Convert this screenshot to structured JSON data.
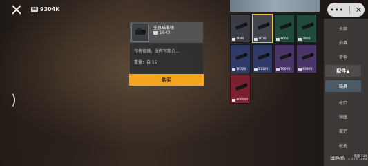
{
  "currency": {
    "amount": "9304K"
  },
  "detail": {
    "name": "全息瞄准镜",
    "price": "1640",
    "description": "作者很懒，没有写简介...",
    "weight": "重量：",
    "weight_value": "自 15",
    "buy_label": "购买"
  },
  "grid": [
    {
      "price": "1640",
      "color": "#3a3e44",
      "selected": false
    },
    {
      "price": "1610",
      "color": "#42464c",
      "selected": true
    },
    {
      "price": "4600",
      "color": "#1f4a3c",
      "selected": false
    },
    {
      "price": "3900",
      "color": "#1f4a3c",
      "selected": false
    },
    {
      "price": "10720",
      "color": "#2f3a66",
      "selected": false
    },
    {
      "price": "21500",
      "color": "#2f3a66",
      "selected": false
    },
    {
      "price": "76600",
      "color": "#4b3466",
      "selected": false
    },
    {
      "price": "43800",
      "color": "#4b3466",
      "selected": false
    },
    {
      "price": "400000",
      "color": "#7a2030",
      "selected": false
    }
  ],
  "sidebar": {
    "items": [
      "头部",
      "护具",
      "背包"
    ],
    "active_category": "配件▲",
    "active_sub": "瞄具",
    "sub_items": [
      "枪口",
      "弹匣",
      "握把",
      "枪托"
    ]
  },
  "bottom": {
    "label": "消耗品",
    "stat1": "电量 119",
    "stat2": "4.33 1.3X64"
  }
}
